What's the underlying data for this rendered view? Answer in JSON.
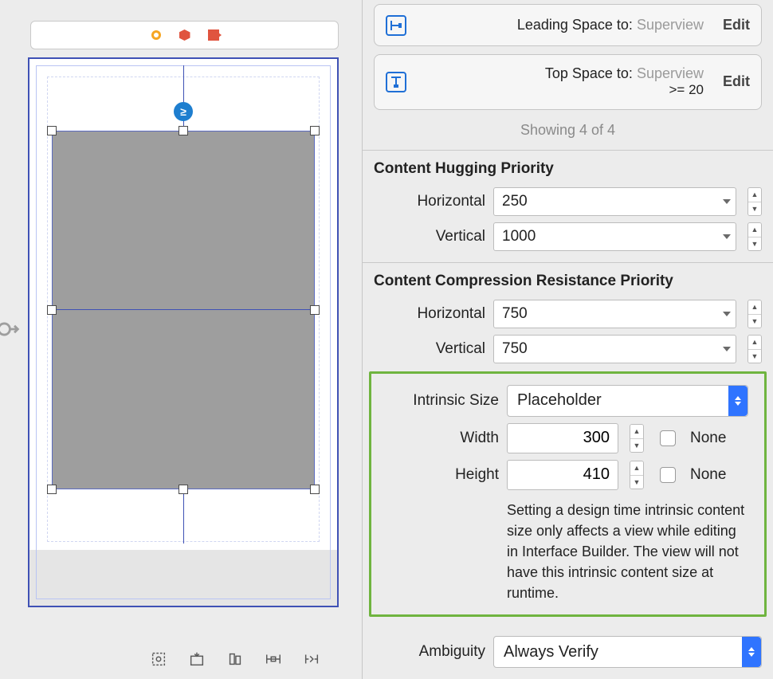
{
  "constraints": {
    "leading": {
      "label": "Leading Space to:",
      "value": "Superview",
      "edit": "Edit"
    },
    "top": {
      "label": "Top Space to:",
      "value": "Superview",
      "sub": ">=  20",
      "edit": "Edit"
    },
    "status": "Showing 4 of 4"
  },
  "hugging": {
    "title": "Content Hugging Priority",
    "horizontal_label": "Horizontal",
    "horizontal_value": "250",
    "vertical_label": "Vertical",
    "vertical_value": "1000"
  },
  "compression": {
    "title": "Content Compression Resistance Priority",
    "horizontal_label": "Horizontal",
    "horizontal_value": "750",
    "vertical_label": "Vertical",
    "vertical_value": "750"
  },
  "intrinsic": {
    "label": "Intrinsic Size",
    "value": "Placeholder",
    "width_label": "Width",
    "width_value": "300",
    "width_none_label": "None",
    "height_label": "Height",
    "height_value": "410",
    "height_none_label": "None",
    "note": "Setting a design time intrinsic content size only affects a view while editing in Interface Builder. The view will not have this intrinsic content size at runtime."
  },
  "ambiguity": {
    "label": "Ambiguity",
    "value": "Always Verify"
  },
  "badge_ge": "≥"
}
